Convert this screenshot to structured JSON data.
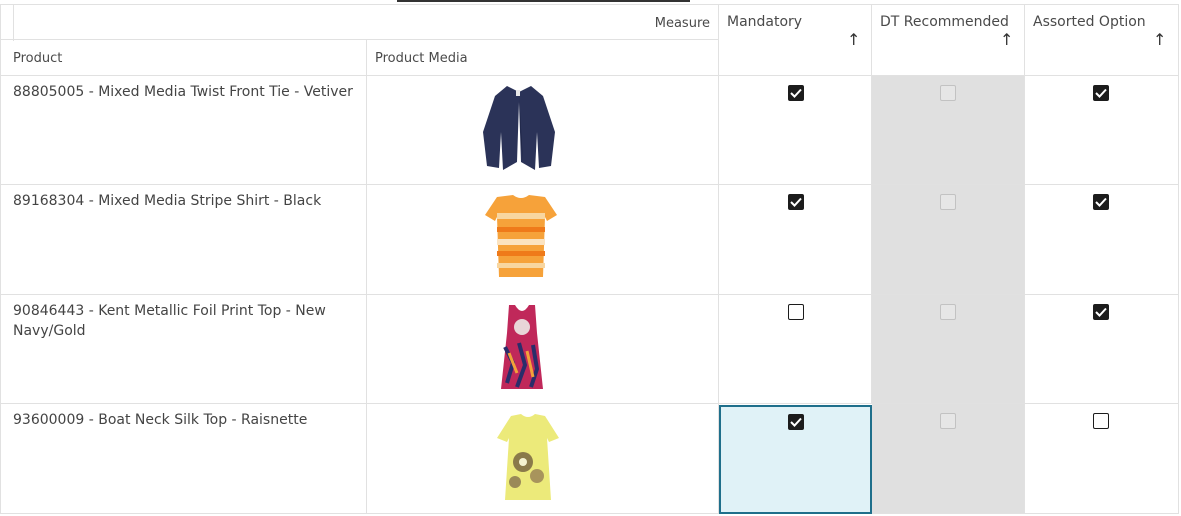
{
  "header": {
    "measure_label": "Measure",
    "col_product": "Product",
    "col_media": "Product Media",
    "col_mandatory": "Mandatory",
    "col_dt": "DT Recommended",
    "col_assorted": "Assorted Option",
    "sort_icon": "arrow-up-icon"
  },
  "rows": [
    {
      "product": "88805005 - Mixed Media Twist Front Tie - Vetiver",
      "mandatory": true,
      "dt_recommended": false,
      "assorted": true,
      "image": "navy-cardigan"
    },
    {
      "product": "89168304 - Mixed Media Stripe Shirt - Black",
      "mandatory": true,
      "dt_recommended": false,
      "assorted": true,
      "image": "orange-striped-shirt"
    },
    {
      "product": "90846443 - Kent Metallic Foil Print Top - New Navy/Gold",
      "mandatory": false,
      "dt_recommended": false,
      "assorted": true,
      "image": "patterned-tank-top"
    },
    {
      "product": "93600009 - Boat Neck Silk Top - Raisnette",
      "mandatory": true,
      "dt_recommended": false,
      "assorted": false,
      "image": "yellow-floral-top"
    }
  ],
  "colors": {
    "selected_border": "#1f6f8b",
    "selected_fill": "#e0f2f7",
    "disabled_column": "#e0e0e0"
  }
}
